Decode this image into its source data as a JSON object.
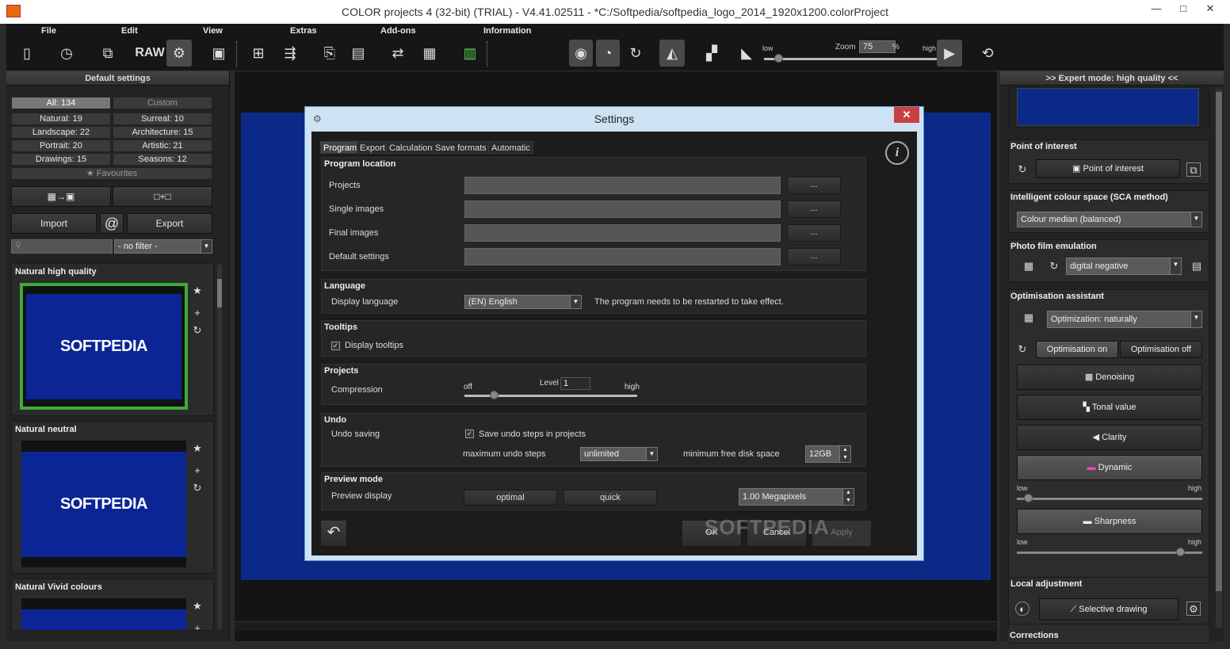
{
  "window": {
    "title": "COLOR projects 4 (32-bit) (TRIAL) - V4.41.02511 - *C:/Softpedia/softpedia_logo_2014_1920x1200.colorProject",
    "minimize": "—",
    "maximize": "□",
    "close": "✕"
  },
  "menu": {
    "file": "File",
    "edit": "Edit",
    "view": "View",
    "extras": "Extras",
    "addons": "Add-ons",
    "information": "Information",
    "raw": "RAW"
  },
  "zoom": {
    "low": "low",
    "high": "high",
    "label": "Zoom",
    "value": "75",
    "unit": "%"
  },
  "left": {
    "title": "Default settings",
    "all": "All: 134",
    "custom": "Custom",
    "cats": [
      "Natural: 19",
      "Surreal: 10",
      "Landscape: 22",
      "Architecture: 15",
      "Portrait: 20",
      "Artistic: 21",
      "Drawings: 15",
      "Seasons: 12"
    ],
    "favourites": "Favourites",
    "import": "Import",
    "at": "@",
    "export": "Export",
    "filter": "- no filter -",
    "presets": [
      {
        "title": "Natural high quality",
        "logo": "SOFTPEDIA"
      },
      {
        "title": "Natural neutral",
        "logo": "SOFTPEDIA"
      },
      {
        "title": "Natural Vivid colours",
        "logo": ""
      }
    ]
  },
  "dialog": {
    "title": "Settings",
    "close": "✕",
    "tabs": [
      "Program",
      "Export",
      "Calculation",
      "Save formats",
      "Automatic"
    ],
    "program_location": "Program location",
    "paths": [
      "Projects",
      "Single images",
      "Final images",
      "Default settings"
    ],
    "dots": "...",
    "language": "Language",
    "display_language": "Display language",
    "lang_value": "(EN) English",
    "lang_note": "The program needs to be restarted to take effect.",
    "tooltips": "Tooltips",
    "display_tooltips": "Display tooltips",
    "projects": "Projects",
    "compression": "Compression",
    "off": "off",
    "level": "Level",
    "level_value": "1",
    "high": "high",
    "compression_fraction": 0.17,
    "undo": "Undo",
    "undo_saving": "Undo saving",
    "save_undo": "Save undo steps in projects",
    "max_undo": "maximum undo steps",
    "max_undo_value": "unlimited",
    "min_disk": "minimum free disk space",
    "min_disk_value": "12GB",
    "preview_mode": "Preview mode",
    "preview_display": "Preview display",
    "optimal": "optimal",
    "quick": "quick",
    "megapixels": "1.00 Megapixels",
    "ok": "OK",
    "cancel": "Cancel",
    "apply": "Apply",
    "watermark": "SOFTPEDIA"
  },
  "right": {
    "title": ">> Expert mode: high quality <<",
    "poi": "Point of interest",
    "poi_btn": "Point of interest",
    "sca": "Intelligent colour space (SCA method)",
    "sca_value": "Colour median (balanced)",
    "film": "Photo film emulation",
    "film_value": "digital negative",
    "opt": "Optimisation assistant",
    "opt_value": "Optimization: naturally",
    "opt_on": "Optimisation on",
    "opt_off": "Optimisation off",
    "denoising": "Denoising",
    "tonal": "Tonal value",
    "clarity": "Clarity",
    "dynamic": "Dynamic",
    "low": "low",
    "high": "high",
    "dynamic_fraction": 0.06,
    "sharpness": "Sharpness",
    "sharpness_fraction": 0.88,
    "local": "Local adjustment",
    "selective": "Selective drawing",
    "corrections": "Corrections"
  }
}
